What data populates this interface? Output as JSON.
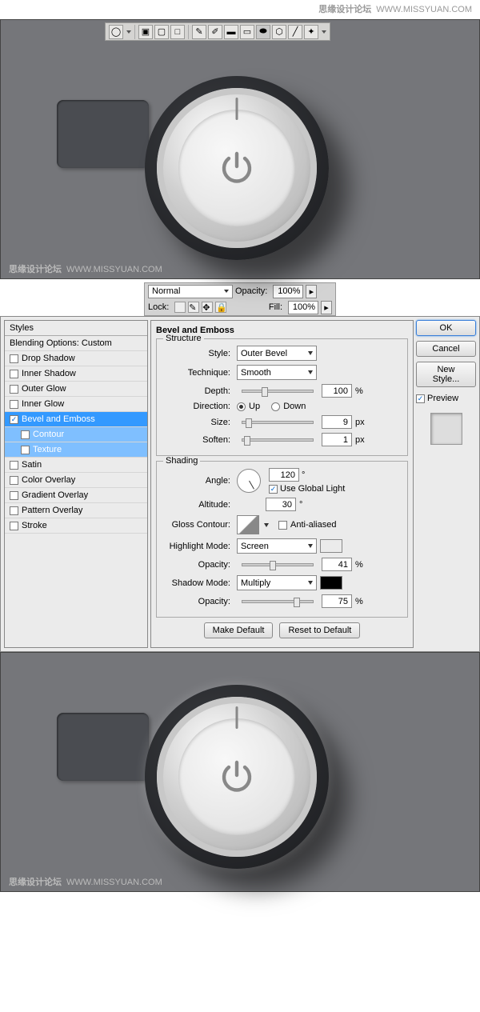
{
  "watermark": {
    "site": "思缘设计论坛",
    "url": "WWW.MISSYUAN.COM"
  },
  "layers": {
    "blend_label": "",
    "blend_value": "Normal",
    "opacity_label": "Opacity:",
    "opacity_value": "100%",
    "lock_label": "Lock:",
    "fill_label": "Fill:",
    "fill_value": "100%"
  },
  "dialog": {
    "styles_hd": "Styles",
    "blending": "Blending Options: Custom",
    "fx": [
      "Drop Shadow",
      "Inner Shadow",
      "Outer Glow",
      "Inner Glow",
      "Bevel and Emboss",
      "Contour",
      "Texture",
      "Satin",
      "Color Overlay",
      "Gradient Overlay",
      "Pattern Overlay",
      "Stroke"
    ],
    "title": "Bevel and Emboss",
    "structure": {
      "legend": "Structure",
      "style_l": "Style:",
      "style_v": "Outer Bevel",
      "tech_l": "Technique:",
      "tech_v": "Smooth",
      "depth_l": "Depth:",
      "depth_v": "100",
      "depth_u": "%",
      "dir_l": "Direction:",
      "up": "Up",
      "down": "Down",
      "size_l": "Size:",
      "size_v": "9",
      "size_u": "px",
      "soft_l": "Soften:",
      "soft_v": "1",
      "soft_u": "px"
    },
    "shading": {
      "legend": "Shading",
      "angle_l": "Angle:",
      "angle_v": "120",
      "angle_u": "°",
      "ugl": "Use Global Light",
      "alt_l": "Altitude:",
      "alt_v": "30",
      "alt_u": "°",
      "gloss_l": "Gloss Contour:",
      "aa": "Anti-aliased",
      "hl_l": "Highlight Mode:",
      "hl_v": "Screen",
      "hlo_l": "Opacity:",
      "hlo_v": "41",
      "hlo_u": "%",
      "hl_color": "#ffffff",
      "sh_l": "Shadow Mode:",
      "sh_v": "Multiply",
      "sho_l": "Opacity:",
      "sho_v": "75",
      "sho_u": "%",
      "sh_color": "#000000"
    },
    "make_default": "Make Default",
    "reset": "Reset to Default",
    "ok": "OK",
    "cancel": "Cancel",
    "newstyle": "New Style...",
    "preview": "Preview"
  }
}
